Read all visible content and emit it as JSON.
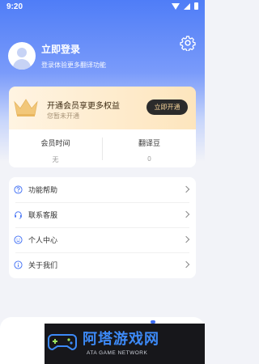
{
  "status_bar": {
    "time": "9:20"
  },
  "profile": {
    "title": "立即登录",
    "subtitle": "登录体验更多翻译功能"
  },
  "vip": {
    "title": "开通会员享更多权益",
    "subtitle": "您暂未开通",
    "button_label": "立即开通"
  },
  "stats": [
    {
      "label": "会员时间",
      "value": "无"
    },
    {
      "label": "翻译豆",
      "value": "0"
    }
  ],
  "menu": [
    {
      "label": "功能帮助",
      "icon": "help-icon"
    },
    {
      "label": "联系客服",
      "icon": "headset-icon"
    },
    {
      "label": "个人中心",
      "icon": "smile-icon"
    },
    {
      "label": "关于我们",
      "icon": "info-icon"
    }
  ],
  "watermark": {
    "title": "阿塔游戏网",
    "subtitle": "ATA GAME NETWORK"
  },
  "colors": {
    "accent": "#4f7df7",
    "vip_gold": "#f5d39a",
    "background": "#f2f3f8"
  }
}
